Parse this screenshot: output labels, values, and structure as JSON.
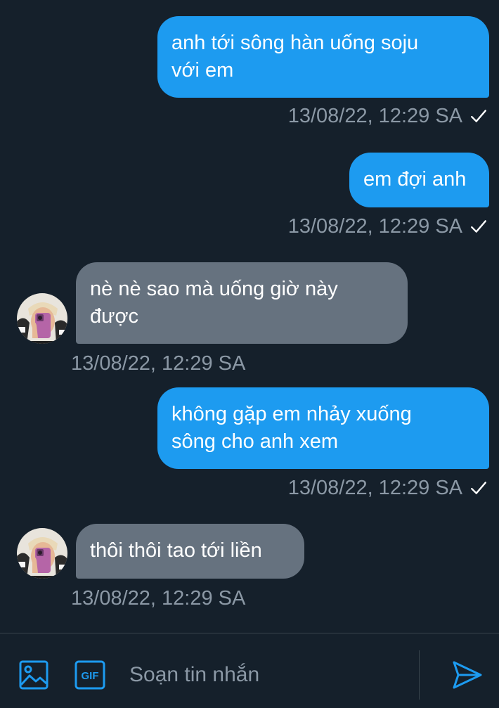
{
  "colors": {
    "background": "#15202b",
    "outgoing_bubble": "#1d9bf0",
    "incoming_bubble": "#66727f",
    "meta_text": "#8b98a5",
    "accent": "#1d9bf0"
  },
  "messages": [
    {
      "direction": "out",
      "text": "anh tới sông hàn uống soju\nvới em",
      "time": "13/08/22, 12:29 SA",
      "read_icon": "check-icon"
    },
    {
      "direction": "out",
      "text": "em đợi anh",
      "time": "13/08/22, 12:29 SA",
      "read_icon": "check-icon"
    },
    {
      "direction": "in",
      "text": "nè nè sao mà uống giờ này\nđược",
      "time": "13/08/22, 12:29 SA",
      "avatar": "avatar-icon"
    },
    {
      "direction": "out",
      "text": "không gặp em nhảy xuống\nsông cho anh xem",
      "time": "13/08/22, 12:29 SA",
      "read_icon": "check-icon"
    },
    {
      "direction": "in",
      "text": "thôi thôi tao tới liền",
      "time": "13/08/22, 12:29 SA",
      "avatar": "avatar-icon"
    }
  ],
  "composer": {
    "placeholder": "Soạn tin nhắn",
    "value": "",
    "image_icon": "image-icon",
    "gif_label": "GIF",
    "send_icon": "send-icon"
  }
}
